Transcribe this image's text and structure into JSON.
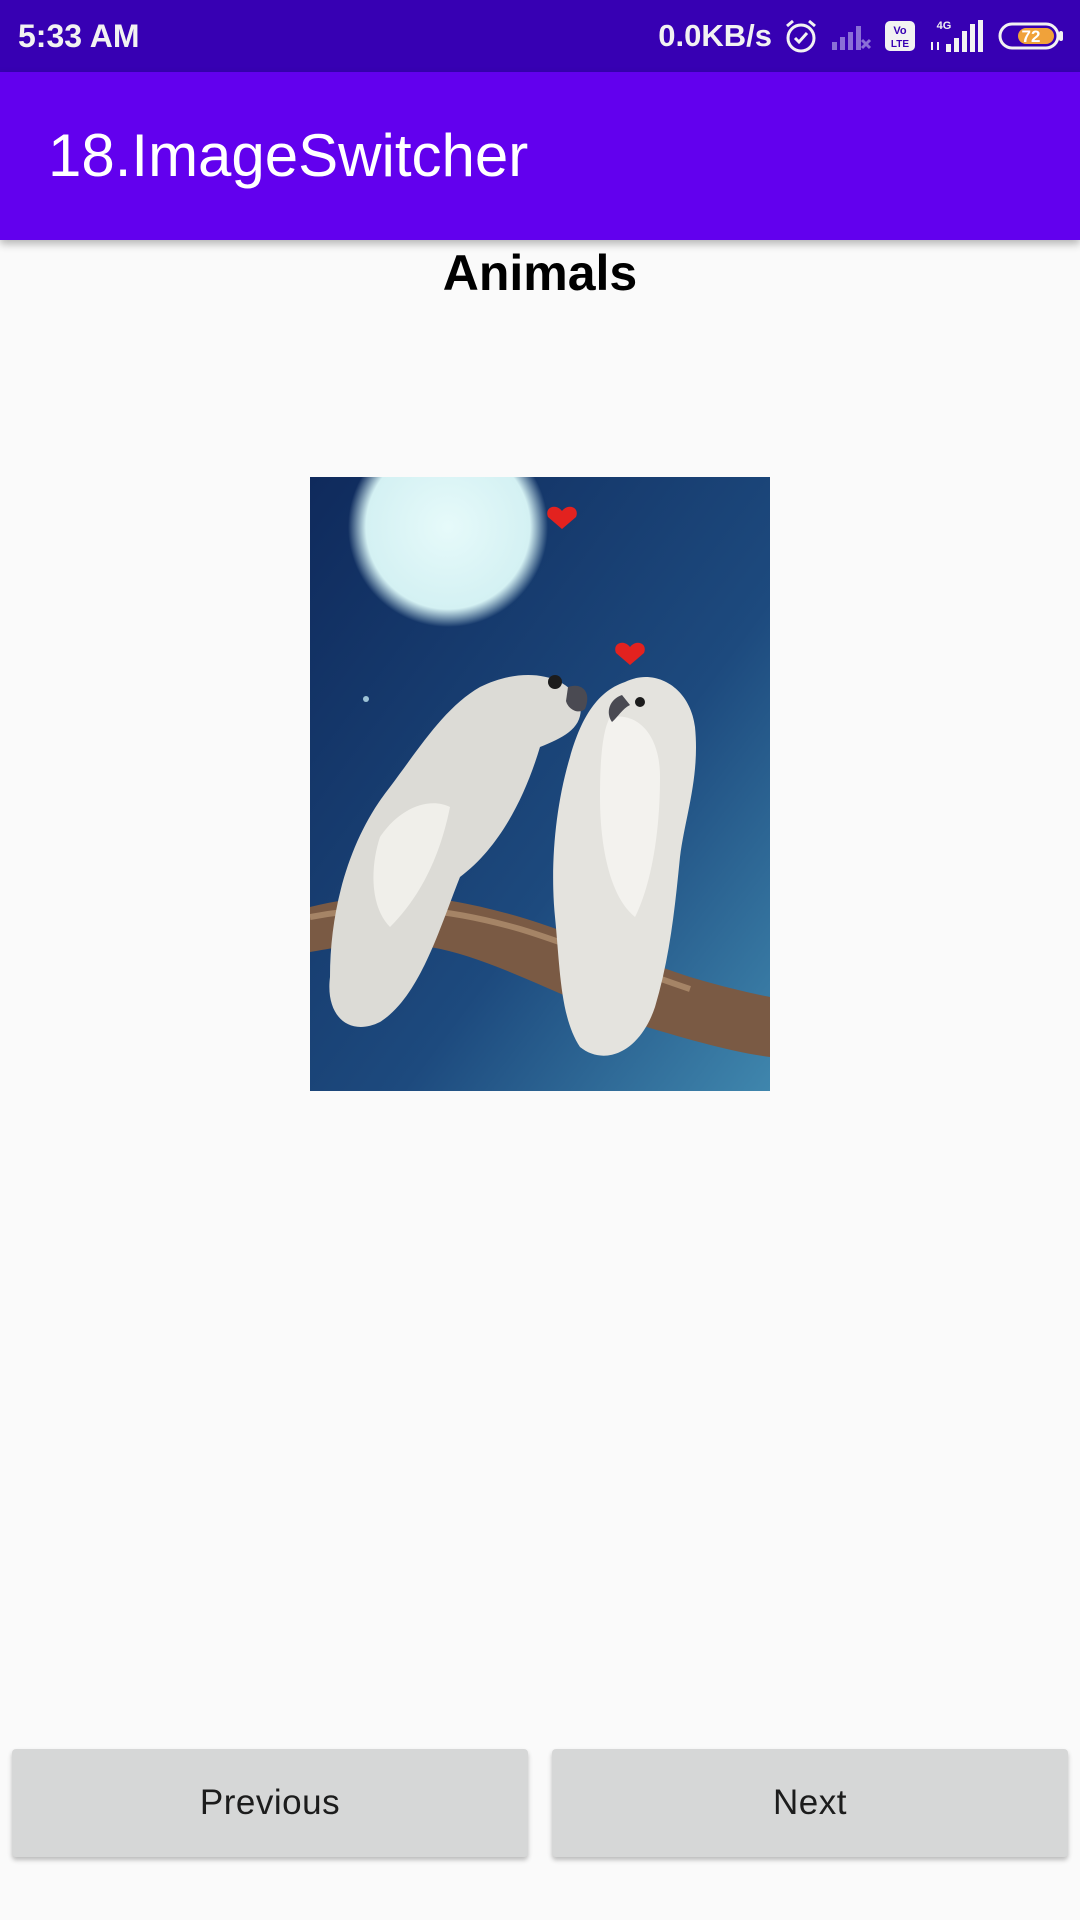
{
  "status_bar": {
    "time": "5:33 AM",
    "net_speed": "0.0KB/s",
    "battery_level": "72",
    "icons": [
      "alarm-icon",
      "signal-off-icon",
      "volte-icon",
      "4g-signal-icon",
      "battery-icon"
    ],
    "volte_text": "Vo\nLTE",
    "network_type": "4G"
  },
  "app_bar": {
    "title": "18.ImageSwitcher",
    "color": "#6200ee"
  },
  "main": {
    "heading": "Animals",
    "image": "two-white-cockatoos-on-branch-under-moon"
  },
  "buttons": {
    "previous": "Previous",
    "next": "Next"
  },
  "colors": {
    "status_bar": "#3700b3",
    "app_bar": "#6200ee",
    "button": "#d6d7d7",
    "background": "#fafafa"
  }
}
